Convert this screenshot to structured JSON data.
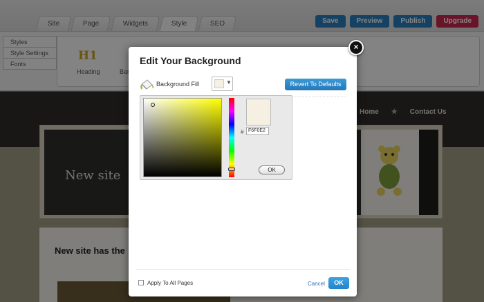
{
  "editor": {
    "tabs": [
      {
        "label": "Site"
      },
      {
        "label": "Page"
      },
      {
        "label": "Widgets"
      },
      {
        "label": "Style"
      },
      {
        "label": "SEO"
      }
    ],
    "actions": {
      "save": "Save",
      "preview": "Preview",
      "publish": "Publish",
      "upgrade": "Upgrade"
    },
    "style_menu": [
      "Styles",
      "Style Settings",
      "Fonts"
    ],
    "style_panel": {
      "h1_icon": "H1",
      "heading_label": "Heading",
      "band_label": "Ban"
    }
  },
  "site": {
    "nav": [
      "Home",
      "Contact Us"
    ],
    "nav_separator": "★",
    "hero_title": "New site",
    "content_title": "New site has the"
  },
  "modal": {
    "title": "Edit Your Background",
    "close": "×",
    "fill_label": "Background Fill",
    "revert_label": "Revert To Defaults",
    "picker": {
      "hash": "#",
      "hex_value": "F6F0E2",
      "ok_label": "OK"
    },
    "apply_all_label": "Apply To All Pages",
    "cancel_label": "Cancel",
    "ok_label": "OK"
  },
  "colors": {
    "selected_fill": "#F6F0E2",
    "accent_blue": "#2a7fbf",
    "upgrade_red": "#c9284f"
  }
}
